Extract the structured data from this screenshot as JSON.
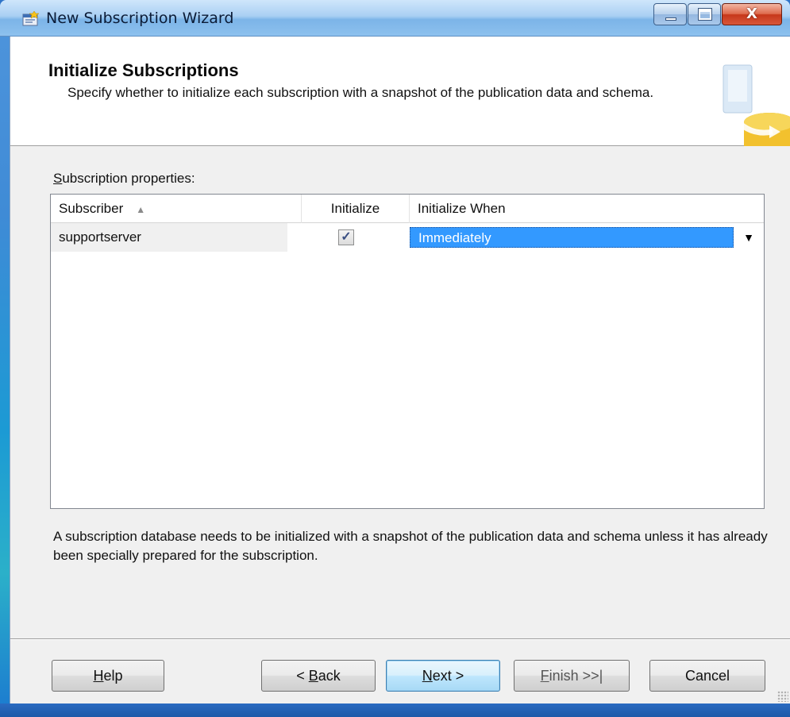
{
  "window": {
    "title": "New Subscription Wizard"
  },
  "header": {
    "title": "Initialize Subscriptions",
    "description": "Specify whether to initialize each subscription with a snapshot of the publication data and schema."
  },
  "subscription_properties": {
    "label_prefix": "S",
    "label_rest": "ubscription properties:",
    "columns": {
      "subscriber": "Subscriber",
      "initialize": "Initialize",
      "initialize_when": "Initialize When"
    },
    "rows": [
      {
        "subscriber": "supportserver",
        "initialize": true,
        "initialize_when": "Immediately"
      }
    ]
  },
  "info": {
    "text": "A subscription database needs to be initialized with a snapshot of the publication data and schema unless it has already been specially prepared for the subscription."
  },
  "buttons": {
    "help": {
      "accel": "H",
      "rest": "elp"
    },
    "back": {
      "prefix": "< ",
      "accel": "B",
      "rest": "ack"
    },
    "next": {
      "accel": "N",
      "rest": "ext >"
    },
    "finish": {
      "accel": "F",
      "rest": "inish >>|"
    },
    "cancel": {
      "label": "Cancel"
    }
  },
  "icons": {
    "app": "wizard-app-icon",
    "minimize": "minimize-icon",
    "maximize": "maximize-icon",
    "close": "close-icon",
    "sort": "sort-ascending-icon",
    "dropdown": "chevron-down-icon",
    "header_graphic": "database-replication-icon"
  },
  "colors": {
    "selection": "#3399ff",
    "titlebar": "#a9cff3",
    "close_button": "#c6371a"
  }
}
